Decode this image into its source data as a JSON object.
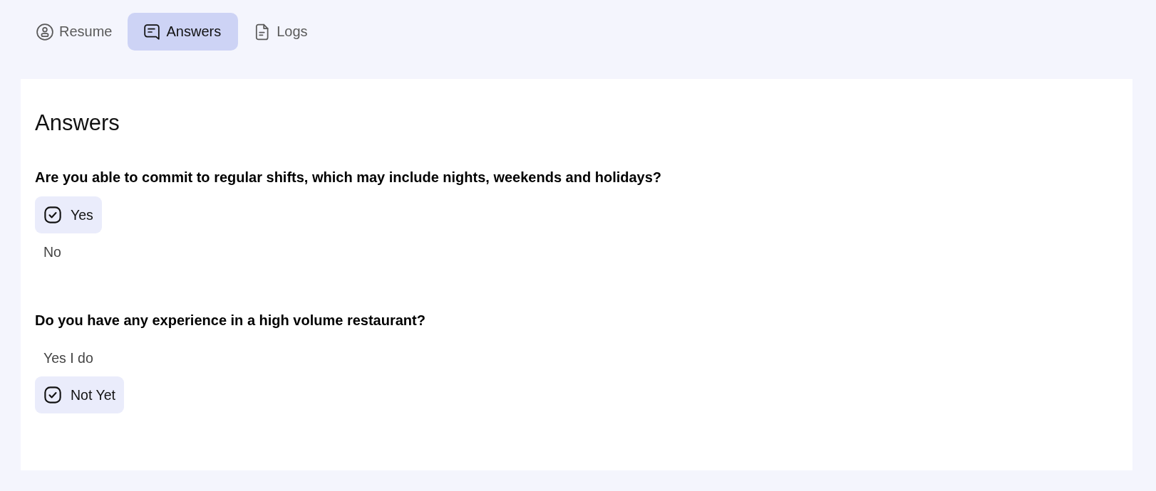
{
  "tabs": [
    {
      "label": "Resume",
      "selected": false
    },
    {
      "label": "Answers",
      "selected": true
    },
    {
      "label": "Logs",
      "selected": false
    }
  ],
  "card": {
    "title": "Answers",
    "questions": [
      {
        "question": "Are you able to commit to regular shifts, which may include nights, weekends and holidays?",
        "options": [
          {
            "label": "Yes",
            "selected": true
          },
          {
            "label": "No",
            "selected": false
          }
        ]
      },
      {
        "question": "Do you have any experience in a high volume restaurant?",
        "options": [
          {
            "label": "Yes I do",
            "selected": false
          },
          {
            "label": "Not Yet",
            "selected": true
          }
        ]
      }
    ]
  }
}
